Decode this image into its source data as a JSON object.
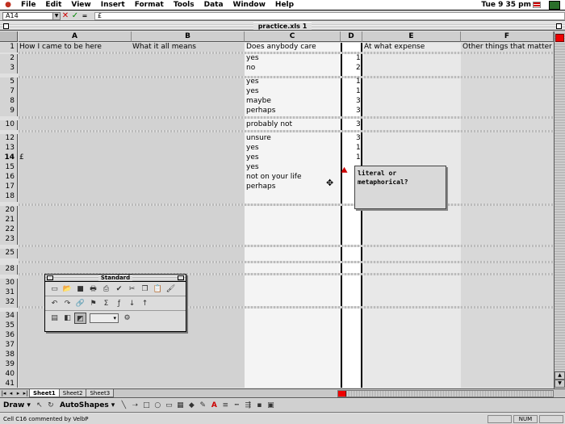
{
  "menubar": {
    "items": [
      "File",
      "Edit",
      "View",
      "Insert",
      "Format",
      "Tools",
      "Data",
      "Window",
      "Help"
    ],
    "clock": "Tue 9 35 pm"
  },
  "formula_bar": {
    "name_box": "A14",
    "cancel_glyph": "✕",
    "enter_glyph": "✓",
    "eq_glyph": "=",
    "content": "£"
  },
  "window": {
    "title": "practice.xls 1"
  },
  "columns": [
    "A",
    "B",
    "C",
    "D",
    "E",
    "F"
  ],
  "rows": [
    {
      "num": "1",
      "a": "How I came to be here",
      "b": "What it all means",
      "c": "Does anybody care",
      "d": "",
      "e": "At what expense",
      "f": "Other things that matter"
    },
    {
      "num": "2",
      "c": "yes",
      "d": "1"
    },
    {
      "num": "3",
      "c": "no",
      "d": "2"
    },
    {
      "num": "5",
      "c": "yes",
      "d": "1"
    },
    {
      "num": "7",
      "c": "yes",
      "d": "1"
    },
    {
      "num": "8",
      "c": "maybe",
      "d": "3"
    },
    {
      "num": "9",
      "c": "perhaps",
      "d": "3"
    },
    {
      "num": "10",
      "c": "probably not",
      "d": "3"
    },
    {
      "num": "12",
      "c": "unsure",
      "d": "3"
    },
    {
      "num": "13",
      "c": "yes",
      "d": "1"
    },
    {
      "num": "14",
      "a": "£",
      "c": "yes",
      "d": "1"
    },
    {
      "num": "15",
      "c": "yes",
      "d": ""
    },
    {
      "num": "16",
      "c": "not on your life",
      "d": ""
    },
    {
      "num": "17",
      "c": "perhaps",
      "d": ""
    },
    {
      "num": "18",
      "c": "",
      "d": ""
    },
    {
      "num": "20"
    },
    {
      "num": "21"
    },
    {
      "num": "22"
    },
    {
      "num": "23"
    },
    {
      "num": "25"
    },
    {
      "num": "28"
    },
    {
      "num": "30"
    },
    {
      "num": "31"
    },
    {
      "num": "32"
    },
    {
      "num": "34"
    },
    {
      "num": "35"
    },
    {
      "num": "36"
    },
    {
      "num": "37"
    },
    {
      "num": "38"
    },
    {
      "num": "39"
    },
    {
      "num": "40"
    },
    {
      "num": "41"
    }
  ],
  "comment": {
    "text": "literal or\nmetaphorical?"
  },
  "standard_palette": {
    "title": "Standard",
    "row1_icons": [
      "new-doc-icon",
      "open-folder-icon",
      "save-icon",
      "print-icon",
      "print-preview-icon",
      "spellcheck-icon",
      "cut-icon",
      "copy-icon",
      "paste-icon",
      "format-painter-icon"
    ],
    "row1_glyphs": [
      "▭",
      "📂",
      "■",
      "🖶",
      "⎙",
      "✔",
      "✂",
      "❐",
      "📋",
      "🖌"
    ],
    "row2_glyphs": [
      "↶",
      "↷",
      "🔗",
      "⚑",
      "Σ",
      "ƒ",
      "↓",
      "↑"
    ],
    "row3_glyphs": [
      "▤",
      "◧",
      "◩",
      "⚙"
    ],
    "zoom_value": "▾"
  },
  "sheet_tabs": [
    "Sheet1",
    "Sheet2",
    "Sheet3"
  ],
  "drawing_toolbar": {
    "draw_label": "Draw ▾",
    "autoshapes_label": "AutoShapes ▾",
    "glyphs": [
      "↖",
      "↻",
      "╲",
      "➝",
      "□",
      "○",
      "▭",
      "▦",
      "◆",
      "✎",
      "A",
      "≡",
      "┅",
      "⇶",
      "▪",
      "▣"
    ]
  },
  "status": {
    "text": "Cell C16 commented by VelbP",
    "num_indicator": "NUM"
  },
  "colors": {
    "selected_col_fill": "#d0d0d0",
    "grid_bg": "#ffffff",
    "scroll_thumb": "#ee0000"
  }
}
